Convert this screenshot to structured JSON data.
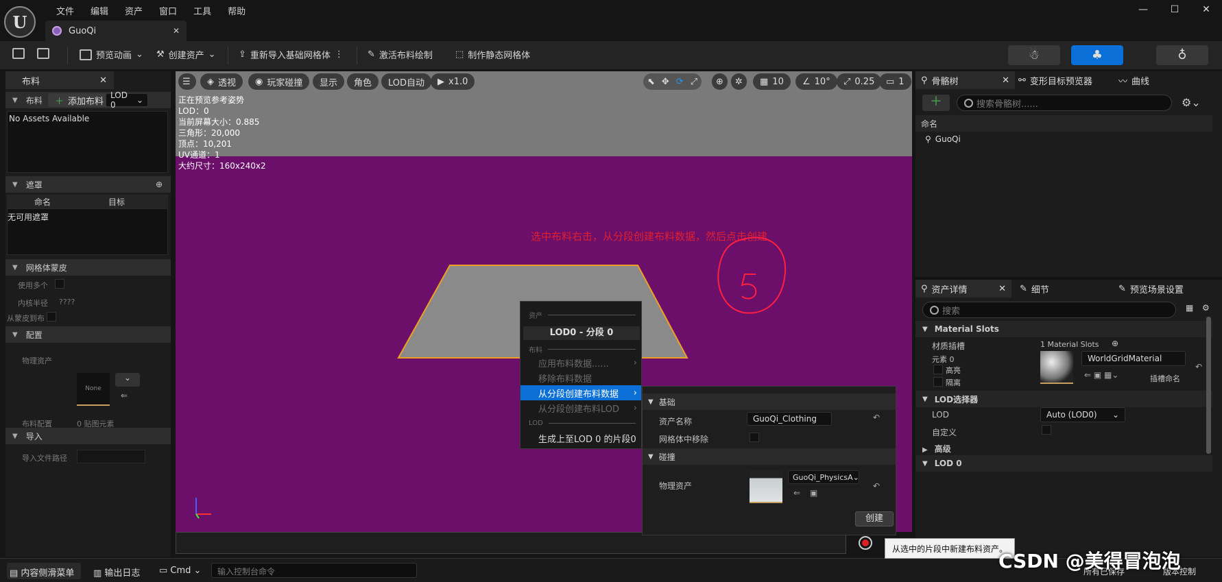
{
  "menu": [
    "文件",
    "编辑",
    "资产",
    "窗口",
    "工具",
    "帮助"
  ],
  "doc_tab": "GuoQi",
  "toolbar": {
    "preview_anim": "预览动画",
    "create_asset": "创建资产",
    "reimport": "重新导入基础网格体",
    "activate_cloth": "激活布料绘制",
    "make_static": "制作静态网格体"
  },
  "left": {
    "tab": "布料",
    "cloth_section": "布料",
    "add_cloth": "添加布料",
    "lod": "LOD 0",
    "no_assets": "No Assets Available",
    "mask_section": "遮罩",
    "col_name": "命名",
    "col_target": "目标",
    "no_mask": "无可用遮罩",
    "skin_section": "网格体蒙皮",
    "use_multi": "使用多个",
    "inner_radius": "内核半径",
    "inner_value": "????",
    "skin_from": "从蒙皮到布",
    "config_section": "配置",
    "physics_asset": "物理资产",
    "none": "None",
    "cloth_config": "布料配置",
    "cloth_config_value": "0 贴图元素",
    "import_section": "导入",
    "import_path": "导入文件路径"
  },
  "viewport": {
    "perspective": "透视",
    "player_collision": "玩家碰撞",
    "show": "显示",
    "character": "角色",
    "lod_auto": "LOD自动",
    "speed": "x1.0",
    "grid": "10",
    "angle": "10°",
    "scale": "0.25",
    "camera": "1",
    "stats": [
      "正在预览参考姿势",
      "LOD：0",
      "当前屏幕大小：0.885",
      "三角形：20,000",
      "顶点：10,201",
      "UV通道：1",
      "大约尺寸：160x240x2"
    ],
    "annotation": "选中布料右击，从分段创建布料数据，然后点击创建"
  },
  "context_menu": {
    "h_asset": "资产",
    "title": "LOD0 - 分段 0",
    "h_cloth": "布料",
    "apply": "应用布料数据......",
    "remove": "移除布料数据",
    "create_from_section": "从分段创建布料数据",
    "create_lod": "从分段创建布料LOD",
    "h_lod": "LOD",
    "gen_lod": "生成上至LOD 0 的片段0"
  },
  "sub_panel": {
    "basic": "基础",
    "asset_name": "资产名称",
    "asset_name_value": "GuoQi_Clothing",
    "remove_from_mesh": "网格体中移除",
    "collision": "碰撞",
    "physics_asset": "物理资产",
    "physics_value": "GuoQi_PhysicsA",
    "create": "创建"
  },
  "right": {
    "tab_skeleton": "骨骼树",
    "tab_morph": "变形目标预览器",
    "tab_curves": "曲线",
    "search_skeleton": "搜索骨骼树......",
    "col_name": "命名",
    "bone": "GuoQi",
    "tab_details": "资产详情",
    "tab_detail": "细节",
    "tab_scene": "预览场景设置",
    "search": "搜索",
    "material_slots": "Material Slots",
    "slot_label": "材质插槽",
    "slot_count": "1 Material Slots",
    "element": "元素 0",
    "highlight": "高亮",
    "isolate": "隔离",
    "material": "WorldGridMaterial",
    "slot_name": "插槽命名",
    "lod_selector": "LOD选择器",
    "lod_label": "LOD",
    "lod_value": "Auto (LOD0)",
    "custom": "自定义",
    "advanced": "高级",
    "lod0": "LOD 0"
  },
  "status": {
    "drawer": "内容侧滑菜单",
    "output": "输出日志",
    "cmd": "Cmd",
    "console_placeholder": "输入控制台命令",
    "save_all": "所有已保存",
    "version": "版本控制"
  },
  "tooltip": "从选中的片段中新建布料资产。",
  "watermark": "CSDN @美得冒泡泡"
}
